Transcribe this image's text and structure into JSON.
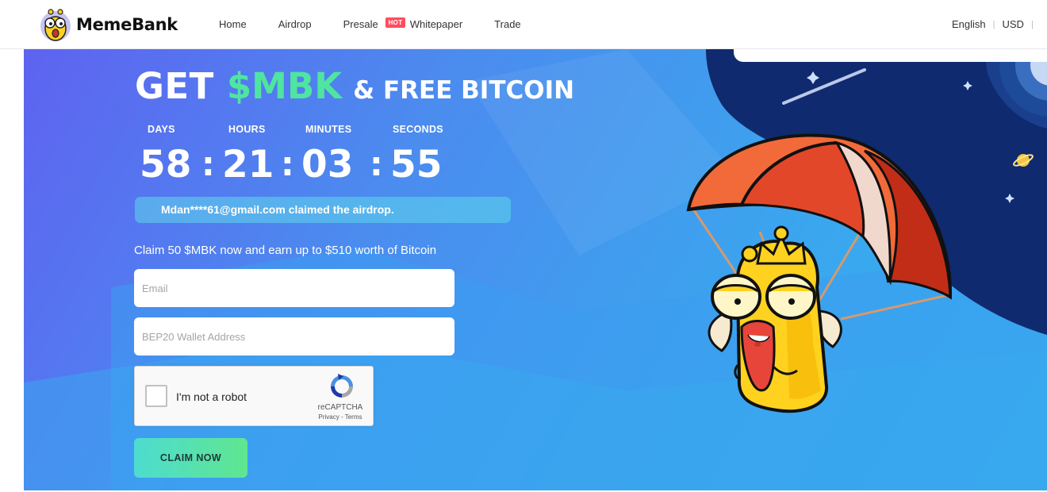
{
  "brand": {
    "name": "MemeBank"
  },
  "nav": {
    "items": [
      "Home",
      "Airdrop",
      "Presale",
      "Whitepaper",
      "Trade"
    ],
    "presale_badge": "HOT"
  },
  "header_right": {
    "language": "English",
    "currency": "USD"
  },
  "hero": {
    "title_get": "GET",
    "title_token": "$MBK",
    "title_free": "& FREE BITCOIN",
    "countdown": {
      "labels": [
        "DAYS",
        "HOURS",
        "MINUTES",
        "SECONDS"
      ],
      "values": [
        "58",
        "21",
        "03",
        "55"
      ],
      "separator": ":"
    },
    "ticker_text": "Mdan****61@gmail.com claimed the airdrop.",
    "claim_text": "Claim 50 $MBK now and earn up to $510 worth of Bitcoin",
    "form": {
      "email_placeholder": "Email",
      "wallet_placeholder": "BEP20 Wallet Address"
    },
    "captcha": {
      "label": "I'm not a robot",
      "brand": "reCAPTCHA",
      "terms": "Privacy - Terms"
    },
    "claim_button": "CLAIM NOW"
  },
  "colors": {
    "accent_green": "#4fe5a0",
    "hero_start": "#5e63f0",
    "hero_end": "#33b3ee",
    "hot_badge": "#ff4d5e",
    "button_start": "#4ddcd0",
    "button_end": "#5fe690"
  },
  "icons": [
    "mascot-logo-icon",
    "recaptcha-icon",
    "parachute-mascot-illustration"
  ]
}
